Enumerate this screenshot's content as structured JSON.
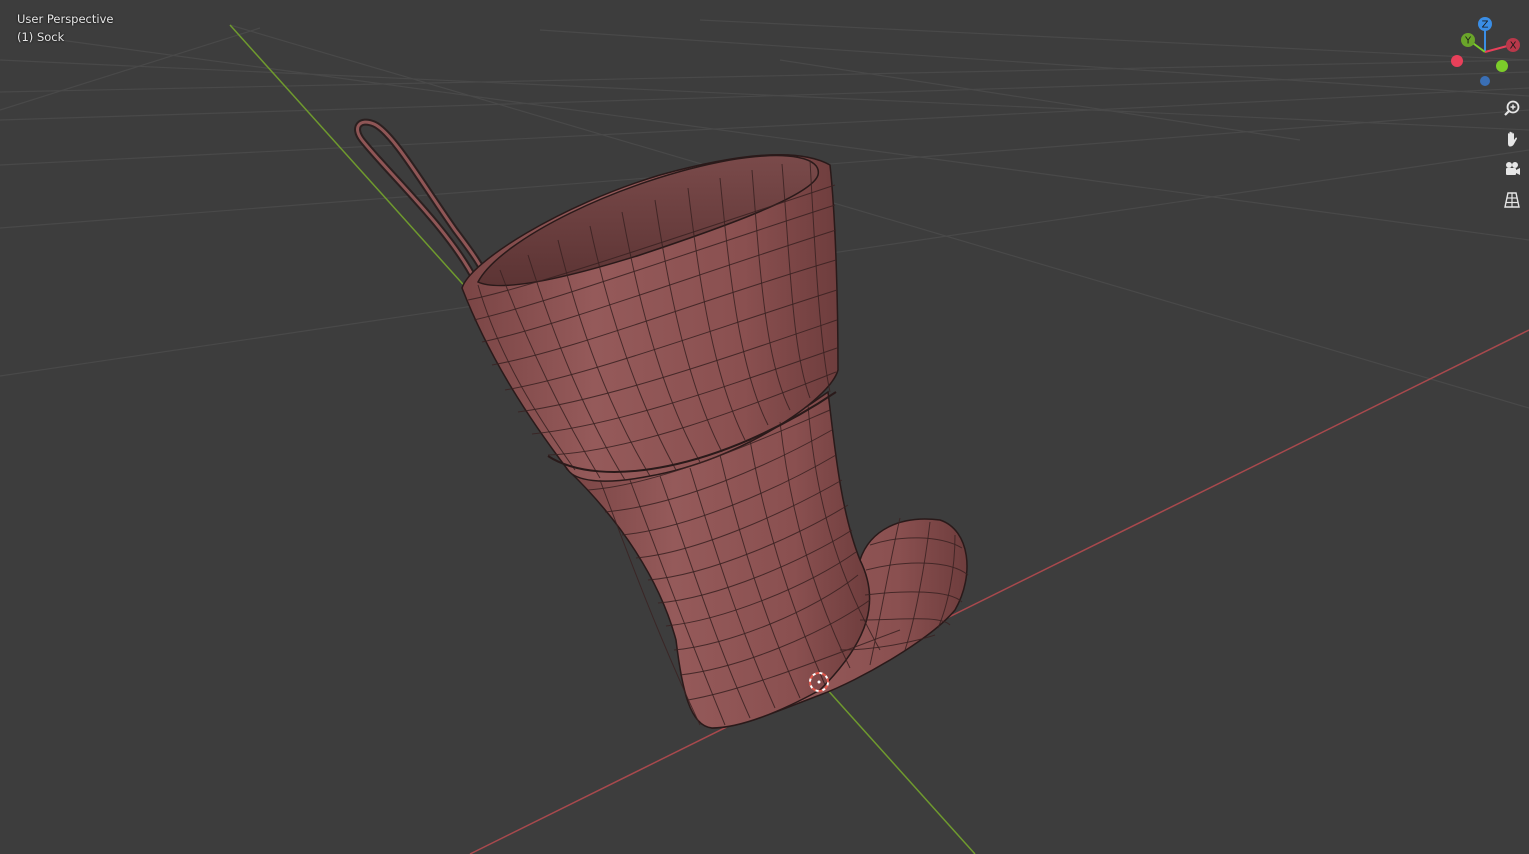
{
  "viewport": {
    "view_name": "User Perspective",
    "object_label": "(1) Sock",
    "background_color": "#3d3d3d",
    "grid_color": "#4a4a4a",
    "x_axis_color": "#a8494d",
    "y_axis_color": "#6f9a2e",
    "mesh_color": "#8f5656"
  },
  "gizmo": {
    "z_label": "Z",
    "y_label": "Y",
    "x_label": "X",
    "x_color": "#e8405a",
    "y_color": "#7ccd2a",
    "z_color": "#3a8ee6"
  },
  "nav_buttons": [
    {
      "name": "zoom",
      "icon": "zoom-in-icon"
    },
    {
      "name": "pan",
      "icon": "hand-icon"
    },
    {
      "name": "camera",
      "icon": "camera-icon"
    },
    {
      "name": "perspective",
      "icon": "grid-perspective-icon"
    }
  ]
}
